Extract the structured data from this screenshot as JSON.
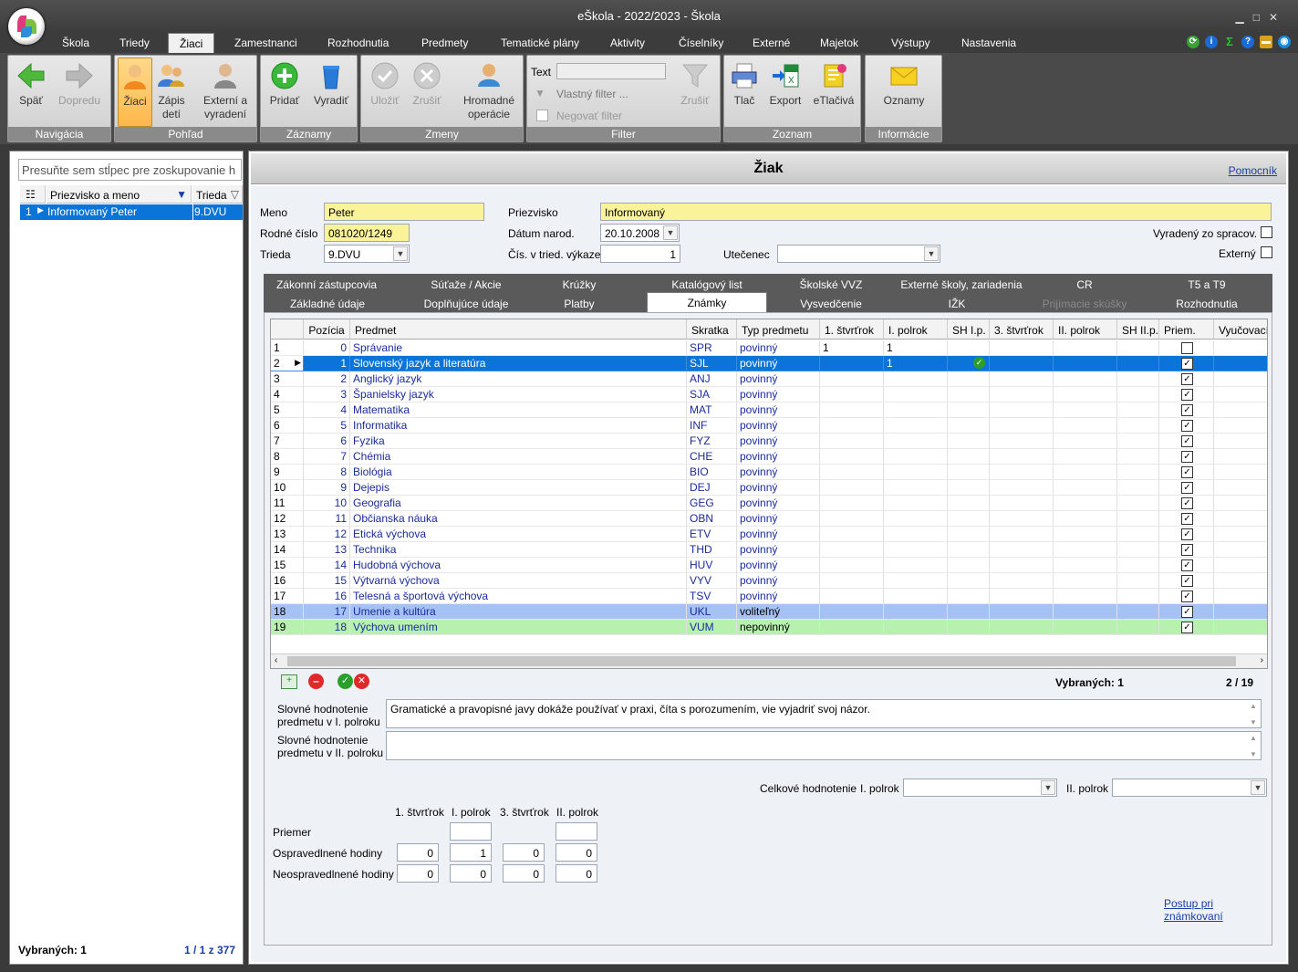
{
  "window": {
    "title": "eŠkola - 2022/2023 - Škola"
  },
  "menu": [
    "Škola",
    "Triedy",
    "Žiaci",
    "Zamestnanci",
    "Rozhodnutia",
    "Predmety",
    "Tematické plány",
    "Aktivity",
    "Číselníky",
    "Externé",
    "Majetok",
    "Výstupy",
    "Nastavenia"
  ],
  "ribbon": {
    "nav": {
      "label": "Navigácia",
      "back": "Späť",
      "forward": "Dopredu"
    },
    "view": {
      "label": "Pohľad",
      "students": "Žiaci",
      "enroll_1": "Zápis",
      "enroll_2": "detí",
      "ext_1": "Externí a",
      "ext_2": "vyradení"
    },
    "records": {
      "label": "Záznamy",
      "add": "Pridať",
      "remove": "Vyradiť"
    },
    "changes": {
      "label": "Zmeny",
      "save": "Uložiť",
      "cancel": "Zrušiť",
      "bulk_1": "Hromadné",
      "bulk_2": "operácie"
    },
    "filter": {
      "label": "Filter",
      "text": "Text",
      "custom": "Vlastný filter ...",
      "negate": "Negovať filter",
      "cancel": "Zrušiť"
    },
    "list": {
      "label": "Zoznam",
      "print": "Tlač",
      "export": "Export",
      "eprint": "eTlačivá"
    },
    "info": {
      "label": "Informácie",
      "notices": "Oznamy"
    }
  },
  "left": {
    "group_hint": "Presuňte sem stĺpec pre zoskupovanie h",
    "col_name": "Priezvisko a meno",
    "col_class": "Trieda",
    "row": {
      "num": "1",
      "name": "Informovaný Peter",
      "class": "9.DVU"
    },
    "selected": "Vybraných: 1",
    "paging": "1 / 1 z 377"
  },
  "main": {
    "title": "Žiak",
    "help": "Pomocník",
    "fields": {
      "meno_l": "Meno",
      "meno": "Peter",
      "priezvisko_l": "Priezvisko",
      "priezvisko": "Informovaný",
      "rc_l": "Rodné číslo",
      "rc": "081020/1249",
      "datum_l": "Dátum narod.",
      "datum": "20.10.2008",
      "trieda_l": "Trieda",
      "trieda": "9.DVU",
      "cis_l": "Čís. v tried. výkaze",
      "cis": "1",
      "utecenec_l": "Utečenec",
      "vyradeny_l": "Vyradený zo spracov.",
      "externy_l": "Externý"
    },
    "tabs_row1": [
      "Zákonní zástupcovia",
      "Súťaže / Akcie",
      "Krúžky",
      "Katalógový list",
      "Školské VVZ",
      "Externé školy, zariadenia",
      "CR",
      "T5 a T9"
    ],
    "tabs_row2": [
      "Základné údaje",
      "Doplňujúce údaje",
      "Platby",
      "Známky",
      "Vysvedčenie",
      "IŽK",
      "Prijímacie skúšky",
      "Rozhodnutia"
    ],
    "columns": [
      "Pozícia",
      "Predmet",
      "Skratka",
      "Typ predmetu",
      "1. štvrťrok",
      "I. polrok",
      "SH I.p.",
      "3. štvrťrok",
      "II. polrok",
      "SH II.p.",
      "Priem.",
      "Vyučovací"
    ],
    "rows": [
      {
        "n": "1",
        "pos": "0",
        "subj": "Správanie",
        "abbr": "SPR",
        "type": "povinný",
        "q1": "1",
        "h1": "1",
        "prm": ""
      },
      {
        "n": "2",
        "pos": "1",
        "subj": "Slovenský jazyk a literatúra",
        "abbr": "SJL",
        "type": "povinný",
        "q1": "",
        "h1": "1",
        "prm": "✓"
      },
      {
        "n": "3",
        "pos": "2",
        "subj": "Anglický jazyk",
        "abbr": "ANJ",
        "type": "povinný",
        "q1": "",
        "h1": "",
        "prm": "✓"
      },
      {
        "n": "4",
        "pos": "3",
        "subj": "Španielsky jazyk",
        "abbr": "SJA",
        "type": "povinný",
        "q1": "",
        "h1": "",
        "prm": "✓"
      },
      {
        "n": "5",
        "pos": "4",
        "subj": "Matematika",
        "abbr": "MAT",
        "type": "povinný",
        "q1": "",
        "h1": "",
        "prm": "✓"
      },
      {
        "n": "6",
        "pos": "5",
        "subj": "Informatika",
        "abbr": "INF",
        "type": "povinný",
        "q1": "",
        "h1": "",
        "prm": "✓"
      },
      {
        "n": "7",
        "pos": "6",
        "subj": "Fyzika",
        "abbr": "FYZ",
        "type": "povinný",
        "q1": "",
        "h1": "",
        "prm": "✓"
      },
      {
        "n": "8",
        "pos": "7",
        "subj": "Chémia",
        "abbr": "CHE",
        "type": "povinný",
        "q1": "",
        "h1": "",
        "prm": "✓"
      },
      {
        "n": "9",
        "pos": "8",
        "subj": "Biológia",
        "abbr": "BIO",
        "type": "povinný",
        "q1": "",
        "h1": "",
        "prm": "✓"
      },
      {
        "n": "10",
        "pos": "9",
        "subj": "Dejepis",
        "abbr": "DEJ",
        "type": "povinný",
        "q1": "",
        "h1": "",
        "prm": "✓"
      },
      {
        "n": "11",
        "pos": "10",
        "subj": "Geografia",
        "abbr": "GEG",
        "type": "povinný",
        "q1": "",
        "h1": "",
        "prm": "✓"
      },
      {
        "n": "12",
        "pos": "11",
        "subj": "Občianska náuka",
        "abbr": "OBN",
        "type": "povinný",
        "q1": "",
        "h1": "",
        "prm": "✓"
      },
      {
        "n": "13",
        "pos": "12",
        "subj": "Etická výchova",
        "abbr": "ETV",
        "type": "povinný",
        "q1": "",
        "h1": "",
        "prm": "✓"
      },
      {
        "n": "14",
        "pos": "13",
        "subj": "Technika",
        "abbr": "THD",
        "type": "povinný",
        "q1": "",
        "h1": "",
        "prm": "✓"
      },
      {
        "n": "15",
        "pos": "14",
        "subj": "Hudobná výchova",
        "abbr": "HUV",
        "type": "povinný",
        "q1": "",
        "h1": "",
        "prm": "✓"
      },
      {
        "n": "16",
        "pos": "15",
        "subj": "Výtvarná výchova",
        "abbr": "VYV",
        "type": "povinný",
        "q1": "",
        "h1": "",
        "prm": "✓"
      },
      {
        "n": "17",
        "pos": "16",
        "subj": "Telesná a športová výchova",
        "abbr": "TSV",
        "type": "povinný",
        "q1": "",
        "h1": "",
        "prm": "✓"
      },
      {
        "n": "18",
        "pos": "17",
        "subj": "Umenie a kultúra",
        "abbr": "UKL",
        "type": "voliteľný",
        "q1": "",
        "h1": "",
        "prm": "✓"
      },
      {
        "n": "19",
        "pos": "18",
        "subj": "Výchova umením",
        "abbr": "VUM",
        "type": "nepovinný",
        "q1": "",
        "h1": "",
        "prm": "✓"
      }
    ],
    "selected": "Vybraných: 1",
    "paging": "2 / 19",
    "verbal1_l1": "Slovné hodnotenie",
    "verbal1_l2": "predmetu v I. polroku",
    "verbal1": "Gramatické a pravopisné javy dokáže používať v praxi, číta s porozumením, vie vyjadriť svoj názor.",
    "verbal2_l1": "Slovné hodnotenie",
    "verbal2_l2": "predmetu v II. polroku",
    "overall_l": "Celkové hodnotenie",
    "h1_l": "I. polrok",
    "h2_l": "II. polrok",
    "sum_cols": [
      "1. štvrťrok",
      "I. polrok",
      "3. štvrťrok",
      "II. polrok"
    ],
    "avg_l": "Priemer",
    "exc_l": "Ospravedlnené hodiny",
    "exc": [
      "0",
      "1",
      "0",
      "0"
    ],
    "unexc_l": "Neospravedlnené hodiny",
    "unexc": [
      "0",
      "0",
      "0",
      "0"
    ],
    "procedure": "Postup pri známkovaní"
  },
  "colors": {
    "selection": "#0a74d8",
    "elective_row": "#a4c2f4",
    "optional_row": "#b8f0b0",
    "field_yellow": "#fbf39a"
  }
}
